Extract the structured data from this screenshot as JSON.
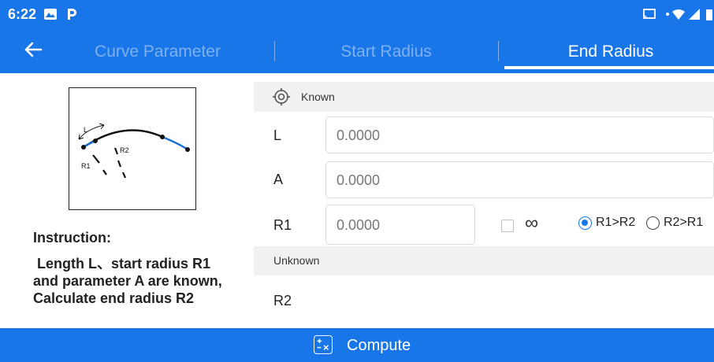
{
  "status_bar": {
    "time": "6:22"
  },
  "tabs": [
    {
      "label": "Curve Parameter",
      "active": false
    },
    {
      "label": "Start Radius",
      "active": false
    },
    {
      "label": "End Radius",
      "active": true
    }
  ],
  "diagram": {
    "label_l": "L",
    "label_r1": "R1",
    "label_r2": "R2"
  },
  "instruction": {
    "title": "Instruction:",
    "body": " Length L、start radius R1 and parameter A are known, Calculate end radius R2"
  },
  "known": {
    "header": "Known",
    "fields": [
      {
        "label": "L",
        "value": "0.0000"
      },
      {
        "label": "A",
        "value": "0.0000"
      },
      {
        "label": "R1",
        "value": "0.0000"
      }
    ],
    "infinity_symbol": "∞",
    "infinity_checked": false,
    "radio_options": [
      "R1>R2",
      "R2>R1"
    ],
    "radio_selected": "R1>R2"
  },
  "unknown": {
    "header": "Unknown",
    "fields": [
      {
        "label": "R2"
      }
    ]
  },
  "compute_label": "Compute",
  "colors": {
    "primary": "#1976e8",
    "section_bg": "#f1f1f1",
    "inactive_tab": "#7fb0f0"
  }
}
